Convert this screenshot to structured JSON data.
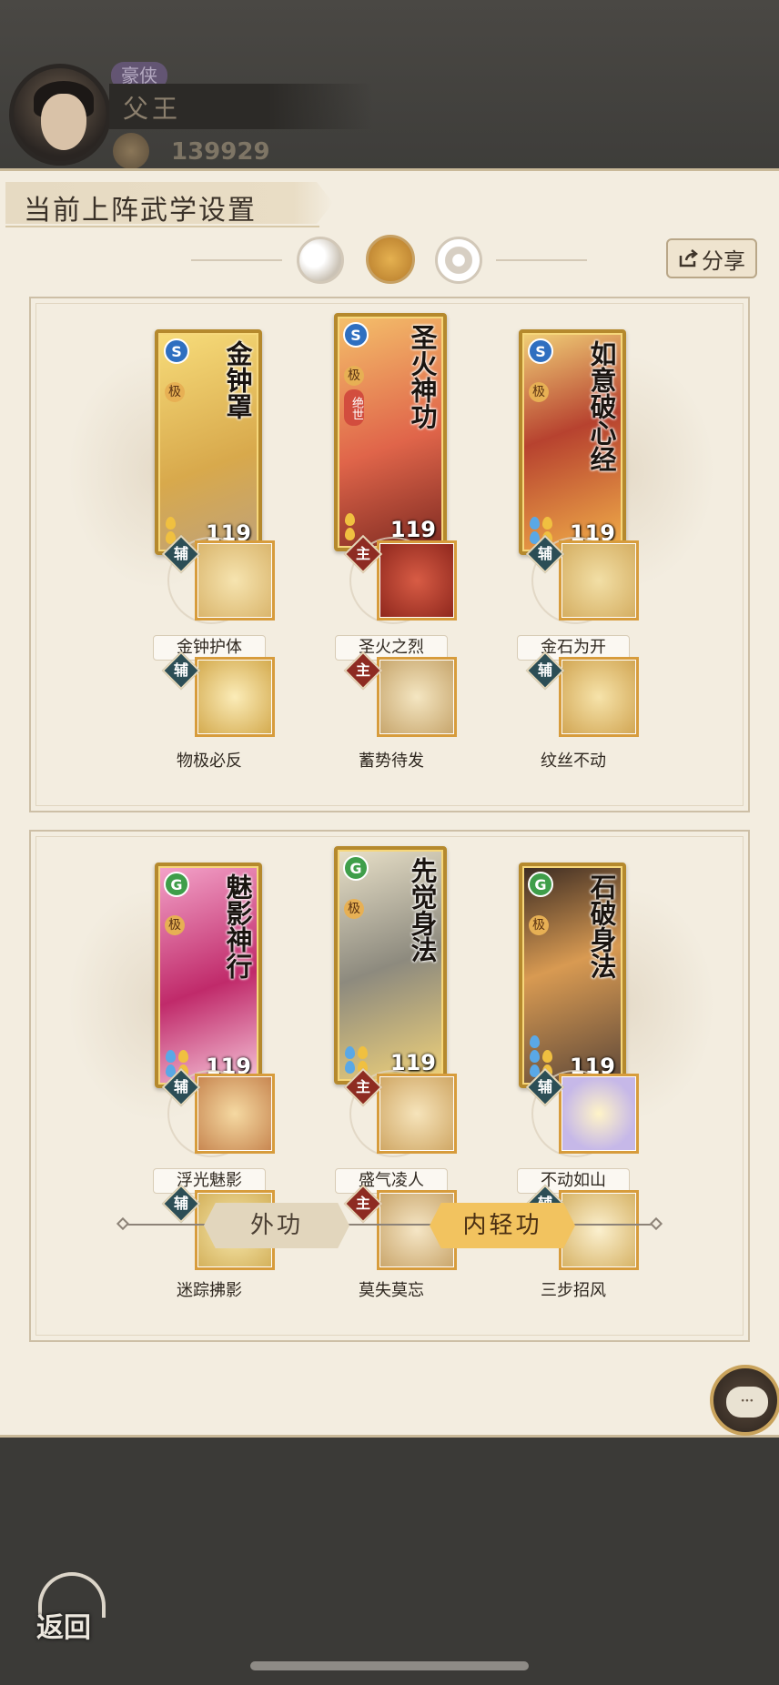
{
  "header": {
    "rank_tag": "豪侠",
    "player_name": "父王",
    "power_value": "139929"
  },
  "panel": {
    "title": "当前上阵武学设置",
    "share_label": "分享",
    "mode_orbs": [
      "moon",
      "sun",
      "ring"
    ]
  },
  "loadouts": [
    {
      "cards": [
        {
          "name": "金钟罩",
          "school": "S",
          "grade": "极",
          "level": "119",
          "pips": [
            [
              "fire"
            ],
            [
              "fire"
            ]
          ]
        },
        {
          "name": "圣火神功",
          "school": "S",
          "grade": "极",
          "extra": "绝世",
          "level": "119",
          "pips": [
            [
              "fire"
            ],
            [
              "fire"
            ]
          ]
        },
        {
          "name": "如意破心经",
          "school": "S",
          "grade": "极",
          "level": "119",
          "pips": [
            [
              "water",
              "fire"
            ],
            [
              "water",
              "fire"
            ]
          ]
        }
      ],
      "skills_row1": [
        {
          "type": "辅",
          "label": "金钟护体"
        },
        {
          "type": "主",
          "label": "圣火之烈"
        },
        {
          "type": "辅",
          "label": "金石为开"
        }
      ],
      "skills_row2": [
        {
          "type": "辅",
          "label": "物极必反"
        },
        {
          "type": "主",
          "label": "蓄势待发"
        },
        {
          "type": "辅",
          "label": "纹丝不动"
        }
      ]
    },
    {
      "cards": [
        {
          "name": "魅影神行",
          "school": "G",
          "grade": "极",
          "level": "119",
          "pips": [
            [
              "water",
              "fire"
            ],
            [
              "water",
              "fire"
            ]
          ]
        },
        {
          "name": "先觉身法",
          "school": "G",
          "grade": "极",
          "level": "119",
          "pips": [
            [
              "water",
              "fire"
            ],
            [
              "water",
              "fire"
            ]
          ]
        },
        {
          "name": "石破身法",
          "school": "G",
          "grade": "极",
          "level": "119",
          "pips": [
            [
              "water"
            ],
            [
              "water",
              "fire"
            ],
            [
              "water",
              "fire"
            ]
          ]
        }
      ],
      "skills_row1": [
        {
          "type": "辅",
          "label": "浮光魅影"
        },
        {
          "type": "主",
          "label": "盛气凌人"
        },
        {
          "type": "辅",
          "label": "不动如山"
        }
      ],
      "skills_row2": [
        {
          "type": "辅",
          "label": "迷踪拂影"
        },
        {
          "type": "主",
          "label": "莫失莫忘"
        },
        {
          "type": "辅",
          "label": "三步招风"
        }
      ]
    }
  ],
  "tabs": {
    "outer": "外功",
    "inner": "内轻功",
    "active": "inner"
  },
  "chat_glyph": "···",
  "footer": {
    "back_label": "返回"
  },
  "colors": {
    "panel_bg": "#f3ede0",
    "page_bg": "#3b3a37",
    "card_border": "#b5892d",
    "active_tab": "#f2c35f",
    "aux_tag": "#2c4e56",
    "main_tag": "#8e2b22"
  }
}
